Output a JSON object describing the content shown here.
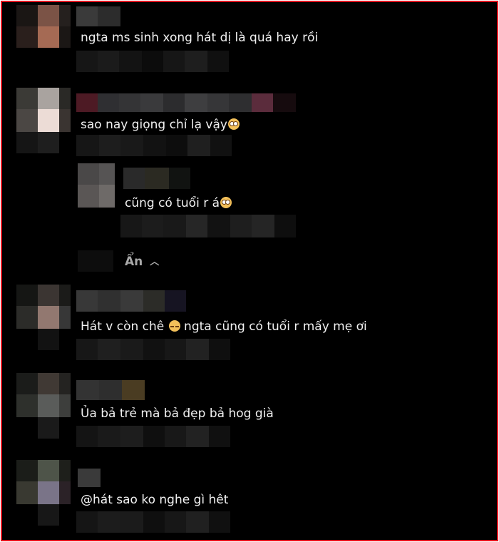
{
  "comments": [
    {
      "text": "ngta ms sinh xong hát dị là quá hay rồi",
      "emoji": ""
    },
    {
      "text": "sao nay giọng chỉ lạ vậy",
      "emoji": "flushed-face"
    },
    {
      "text": "cũng có tuổi r á",
      "emoji": "flushed-face"
    },
    {
      "text": "Hát v còn chê ",
      "emoji": "pensive-face",
      "after": " ngta cũng có tuổi r mấy mẹ ơi"
    },
    {
      "text": "Ủa bả trẻ mà bả đẹp bả hog già",
      "emoji": ""
    },
    {
      "text": "@hát sao ko nghe gì hêt",
      "emoji": ""
    }
  ],
  "replies_toggle": {
    "label": "Ẩn",
    "icon": "chevron-up-icon"
  },
  "colors": {
    "background": "#000000",
    "border": "#e0141e",
    "text": "#f1f1f1",
    "muted": "#a8a8a8"
  }
}
